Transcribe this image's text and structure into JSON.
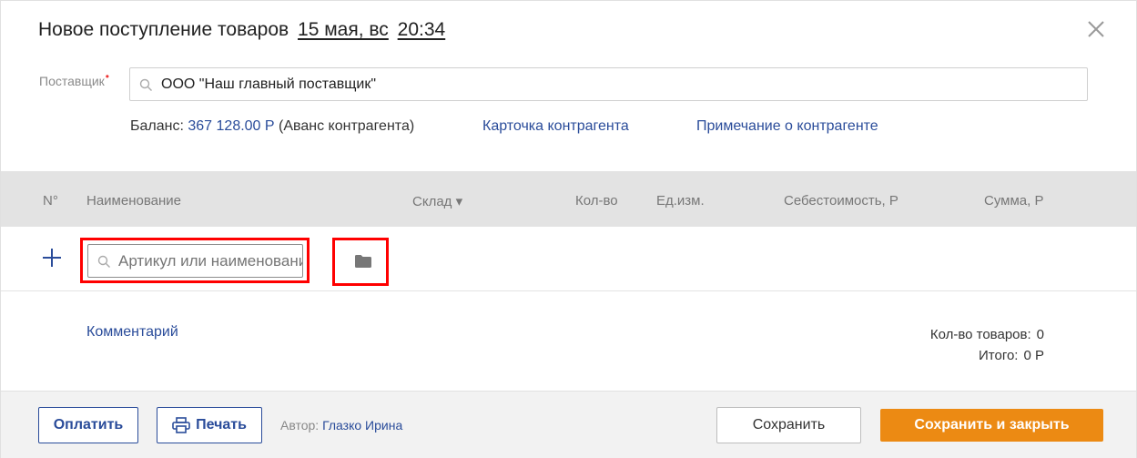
{
  "header": {
    "title": "Новое поступление товаров",
    "date": "15 мая, вс",
    "time": "20:34",
    "close_icon": "close-icon"
  },
  "supplier": {
    "label": "Поставщик",
    "required_mark": "•",
    "value": "ООО \"Наш главный поставщик\""
  },
  "info": {
    "balance_label": "Баланс:",
    "balance_amount": "367 128.00 Р",
    "balance_note": "(Аванс контрагента)",
    "card_link": "Карточка контрагента",
    "note_link": "Примечание о контрагенте"
  },
  "table": {
    "headers": {
      "num": "N°",
      "name": "Наименование",
      "warehouse": "Склад ▾",
      "qty": "Кол-во",
      "unit": "Ед.изм.",
      "cost": "Себестоимость, Р",
      "sum": "Сумма, Р"
    },
    "add_row": {
      "search_placeholder": "Артикул или наименование"
    }
  },
  "summary": {
    "comment_link": "Комментарий",
    "count_label": "Кол-во товаров:",
    "count_value": "0",
    "total_label": "Итого:",
    "total_value": "0 Р"
  },
  "footer": {
    "pay_label": "Оплатить",
    "print_label": "Печать",
    "author_label": "Автор:",
    "author_name": "Глазко Ирина",
    "save_label": "Сохранить",
    "save_close_label": "Сохранить и закрыть"
  },
  "colors": {
    "accent": "#2a4c9a",
    "primary_button": "#ec8a13",
    "highlight": "#ff0000"
  }
}
